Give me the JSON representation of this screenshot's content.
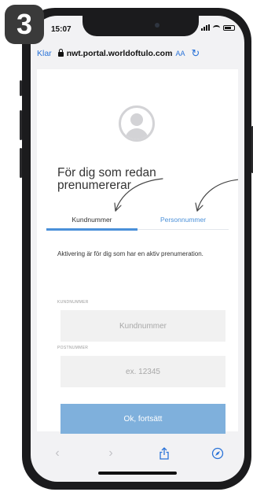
{
  "step_badge": "3",
  "status_bar": {
    "time": "15:07"
  },
  "browser": {
    "done_label": "Klar",
    "url": "nwt.portal.worldoftulo.com",
    "text_size_label": "AA"
  },
  "page": {
    "heading": "För dig som redan prenumererar",
    "tabs": [
      {
        "label": "Kundnummer",
        "active": true
      },
      {
        "label": "Personnummer",
        "active": false
      }
    ],
    "description": "Aktivering är för dig som har en aktiv prenumeration.",
    "fields": [
      {
        "label": "KUNDNUMMER",
        "placeholder": "Kundnummer",
        "value": ""
      },
      {
        "label": "POSTNUMMER",
        "placeholder": "ex. 12345",
        "value": ""
      }
    ],
    "submit_label": "Ok, fortsätt"
  },
  "colors": {
    "accent": "#4a90d9",
    "button": "#7fb0dc",
    "link": "#2a73d8"
  },
  "icons": [
    "lock-icon",
    "reload-icon",
    "back-icon",
    "forward-icon",
    "share-icon",
    "compass-icon",
    "avatar-icon",
    "arrow-annotation-icon"
  ]
}
